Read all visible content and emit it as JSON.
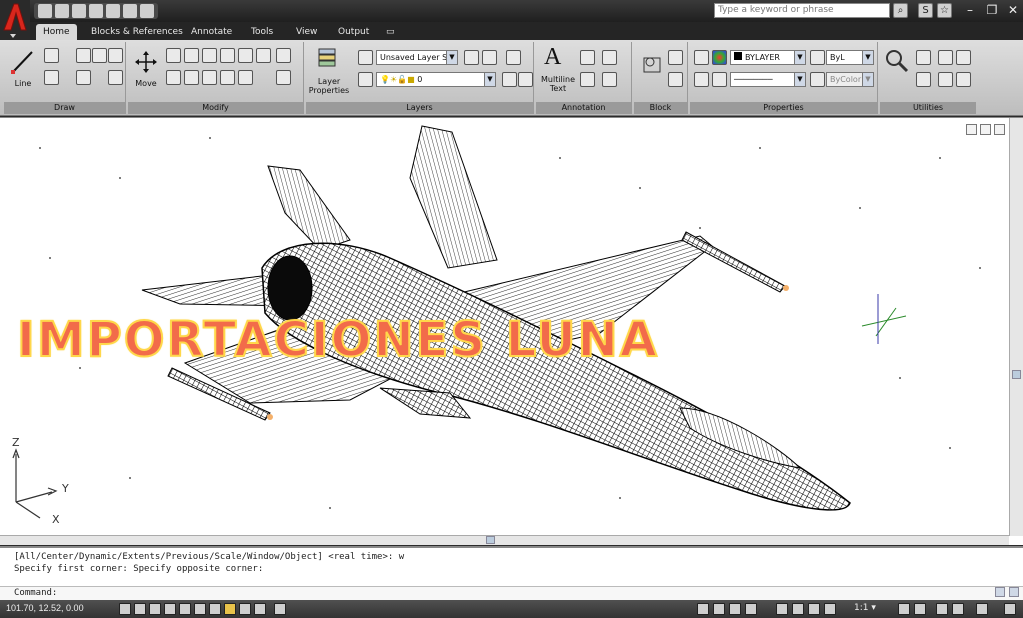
{
  "quick_access": {
    "search_placeholder": "Type a keyword or phrase"
  },
  "tabs": [
    "Home",
    "Blocks & References",
    "Annotate",
    "Tools",
    "View",
    "Output"
  ],
  "ribbon": {
    "draw": {
      "label": "Draw",
      "line_label": "Line"
    },
    "modify": {
      "label": "Modify",
      "move_label": "Move"
    },
    "layers": {
      "label": "Layers",
      "layer_properties_label": "Layer\nProperties",
      "layer_state": "Unsaved Layer S",
      "current_layer": "0"
    },
    "annotation": {
      "label": "Annotation",
      "mtext_label": "Multiline\nText"
    },
    "block": {
      "label": "Block"
    },
    "properties": {
      "label": "Properties",
      "color": "BYLAYER",
      "linetype": "ByL",
      "plotstyle": "ByColor"
    },
    "utilities": {
      "label": "Utilities"
    }
  },
  "watermark": "IMPORTACIONES LUNA",
  "ucs": {
    "z": "Z",
    "y": "Y",
    "x": "X"
  },
  "command": {
    "history": [
      "[All/Center/Dynamic/Extents/Previous/Scale/Window/Object] <real time>: w",
      "Specify first corner: Specify opposite corner:"
    ],
    "prompt": "Command:"
  },
  "status": {
    "coords": "101.70, 12.52, 0.00",
    "scale": "1:1"
  },
  "colors": {
    "watermark_fill": "#f26b4a",
    "watermark_outline": "#ffd74a",
    "autocad_red": "#d8261c"
  }
}
